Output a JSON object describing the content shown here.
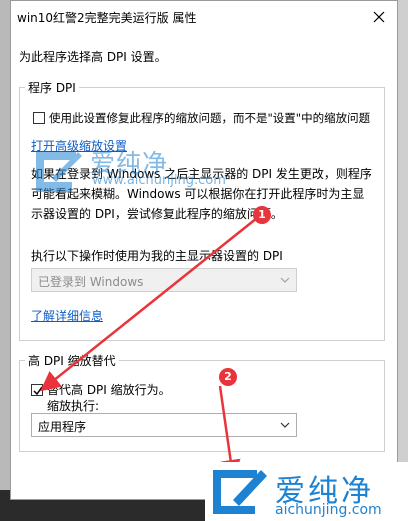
{
  "window": {
    "title": "win10红警2完整完美运行版 属性"
  },
  "subtitle": "为此程序选择高 DPI 设置。",
  "program_dpi": {
    "group_title": "程序 DPI",
    "checkbox_label": "使用此设置修复此程序的缩放问题，而不是\"设置\"中的缩放问题",
    "checked": false,
    "advanced_link": "打开高级缩放设置",
    "paragraph_lines": [
      "如果在登录到 Windows 之后主显示器的 DPI 发生更改，则程序",
      "可能看起来模糊。Windows 可以根据你在打开此程序时为主显",
      "示器设置的 DPI，尝试修复此程序的缩放问题。"
    ],
    "dropdown_label": "执行以下操作时使用为我的主显示器设置的 DPI",
    "dropdown_value": "已登录到 Windows",
    "learn_more_link": "了解详细信息"
  },
  "high_dpi": {
    "group_title": "高 DPI 缩放替代",
    "checkbox_label": "替代高 DPI 缩放行为。",
    "checked": true,
    "scaling_label": "缩放执行:",
    "scaling_value": "应用程序"
  },
  "annotations": {
    "badge1": "1",
    "badge2": "2",
    "color": "#e8343a"
  },
  "watermark": {
    "brand": "爱纯净",
    "url": "aichunjing.com",
    "url_faint": "www.aichunjing.com"
  }
}
